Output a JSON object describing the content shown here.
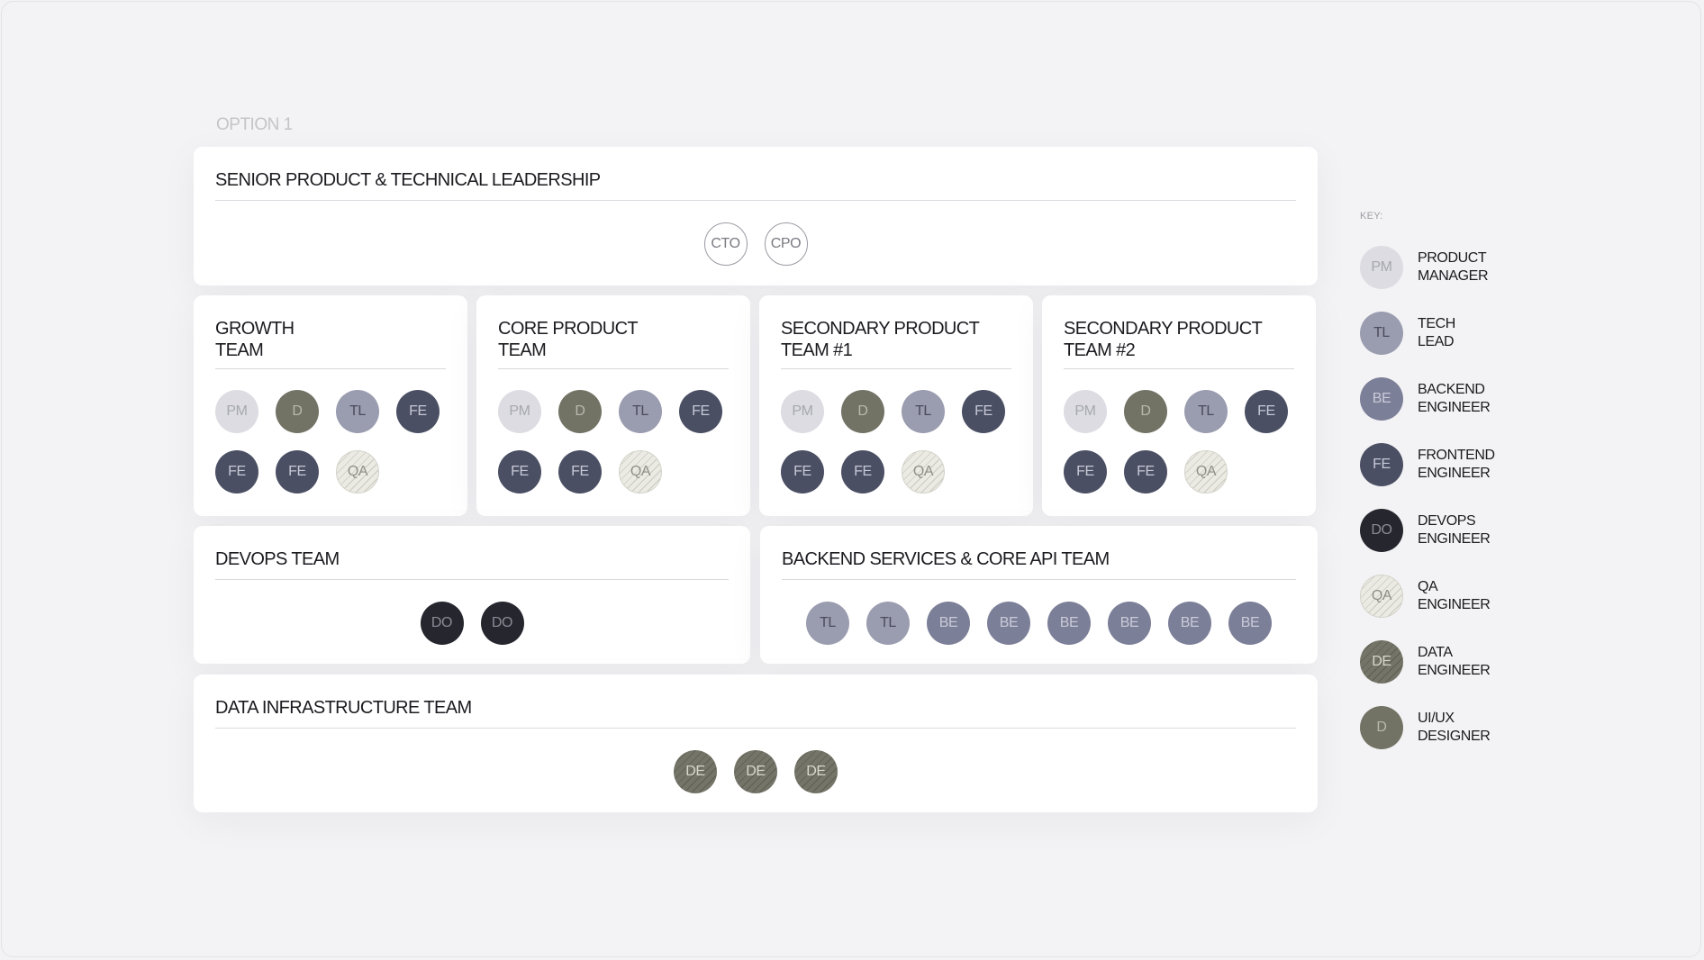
{
  "option_label": "OPTION 1",
  "leadership": {
    "title": "SENIOR PRODUCT & TECHNICAL LEADERSHIP",
    "members": [
      "CTO",
      "CPO"
    ]
  },
  "teams": [
    {
      "title": "GROWTH\nTEAM",
      "members": [
        "PM",
        "D",
        "TL",
        "FE",
        "FE",
        "FE",
        "QA"
      ]
    },
    {
      "title": "CORE PRODUCT\nTEAM",
      "members": [
        "PM",
        "D",
        "TL",
        "FE",
        "FE",
        "FE",
        "QA"
      ]
    },
    {
      "title": "SECONDARY PRODUCT\nTEAM #1",
      "members": [
        "PM",
        "D",
        "TL",
        "FE",
        "FE",
        "FE",
        "QA"
      ]
    },
    {
      "title": "SECONDARY PRODUCT\nTEAM #2",
      "members": [
        "PM",
        "D",
        "TL",
        "FE",
        "FE",
        "FE",
        "QA"
      ]
    }
  ],
  "devops": {
    "title": "DEVOPS TEAM",
    "members": [
      "DO",
      "DO"
    ]
  },
  "backend": {
    "title": "BACKEND SERVICES & CORE API TEAM",
    "members": [
      "TL",
      "TL",
      "BE",
      "BE",
      "BE",
      "BE",
      "BE",
      "BE"
    ]
  },
  "data_infra": {
    "title": "DATA INFRASTRUCTURE TEAM",
    "members": [
      "DE",
      "DE",
      "DE"
    ]
  },
  "key": {
    "title": "KEY:",
    "items": [
      {
        "code": "PM",
        "label": "PRODUCT\nMANAGER"
      },
      {
        "code": "TL",
        "label": "TECH\nLEAD"
      },
      {
        "code": "BE",
        "label": "BACKEND\nENGINEER"
      },
      {
        "code": "FE",
        "label": "FRONTEND\nENGINEER"
      },
      {
        "code": "DO",
        "label": "DEVOPS\nENGINEER"
      },
      {
        "code": "QA",
        "label": "QA\nENGINEER"
      },
      {
        "code": "DE",
        "label": "DATA\nENGINEER"
      },
      {
        "code": "D",
        "label": "UI/UX\nDESIGNER"
      }
    ]
  }
}
